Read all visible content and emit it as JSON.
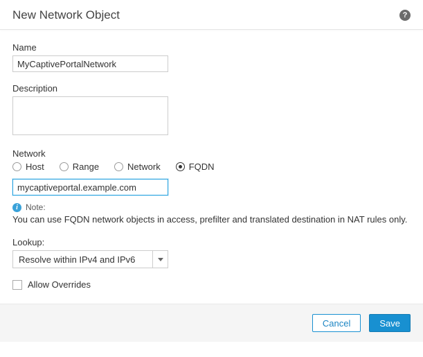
{
  "header": {
    "title": "New Network Object",
    "helpGlyph": "?"
  },
  "fields": {
    "name": {
      "label": "Name",
      "value": "MyCaptivePortalNetwork"
    },
    "description": {
      "label": "Description",
      "value": ""
    },
    "network": {
      "label": "Network",
      "options": [
        "Host",
        "Range",
        "Network",
        "FQDN"
      ],
      "selected": "FQDN",
      "value": "mycaptiveportal.example.com"
    },
    "note": {
      "head": "Note:",
      "text": "You can use FQDN network objects in access, prefilter and translated destination in NAT rules only."
    },
    "lookup": {
      "label": "Lookup:",
      "value": "Resolve within IPv4 and IPv6"
    },
    "allowOverrides": {
      "label": "Allow Overrides",
      "checked": false
    }
  },
  "footer": {
    "cancel": "Cancel",
    "save": "Save"
  }
}
